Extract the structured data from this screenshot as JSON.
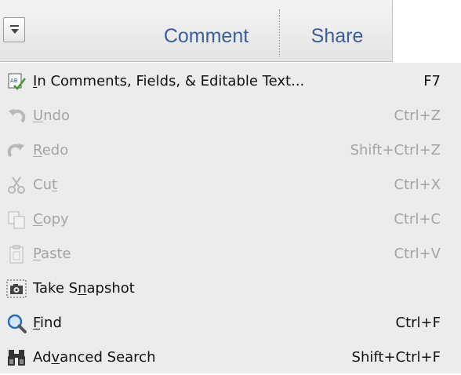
{
  "toolbar": {
    "tabs": [
      {
        "label": "Comment"
      },
      {
        "label": "Share"
      }
    ]
  },
  "menu": {
    "items": [
      {
        "pre": "",
        "key": "I",
        "post": "n Comments, Fields, & Editable Text...",
        "shortcut": "F7",
        "enabled": true,
        "icon": "spellcheck-icon"
      },
      {
        "pre": "",
        "key": "U",
        "post": "ndo",
        "shortcut": "Ctrl+Z",
        "enabled": false,
        "icon": "undo-icon"
      },
      {
        "pre": "",
        "key": "R",
        "post": "edo",
        "shortcut": "Shift+Ctrl+Z",
        "enabled": false,
        "icon": "redo-icon"
      },
      {
        "pre": "Cu",
        "key": "t",
        "post": "",
        "shortcut": "Ctrl+X",
        "enabled": false,
        "icon": "scissors-icon"
      },
      {
        "pre": "",
        "key": "C",
        "post": "opy",
        "shortcut": "Ctrl+C",
        "enabled": false,
        "icon": "copy-icon"
      },
      {
        "pre": "",
        "key": "P",
        "post": "aste",
        "shortcut": "Ctrl+V",
        "enabled": false,
        "icon": "paste-icon"
      },
      {
        "pre": "Take S",
        "key": "n",
        "post": "apshot",
        "shortcut": "",
        "enabled": true,
        "icon": "camera-icon"
      },
      {
        "pre": "",
        "key": "F",
        "post": "ind",
        "shortcut": "Ctrl+F",
        "enabled": true,
        "icon": "magnifier-icon"
      },
      {
        "pre": "Ad",
        "key": "v",
        "post": "anced Search",
        "shortcut": "Shift+Ctrl+F",
        "enabled": true,
        "icon": "binoculars-icon"
      }
    ]
  }
}
